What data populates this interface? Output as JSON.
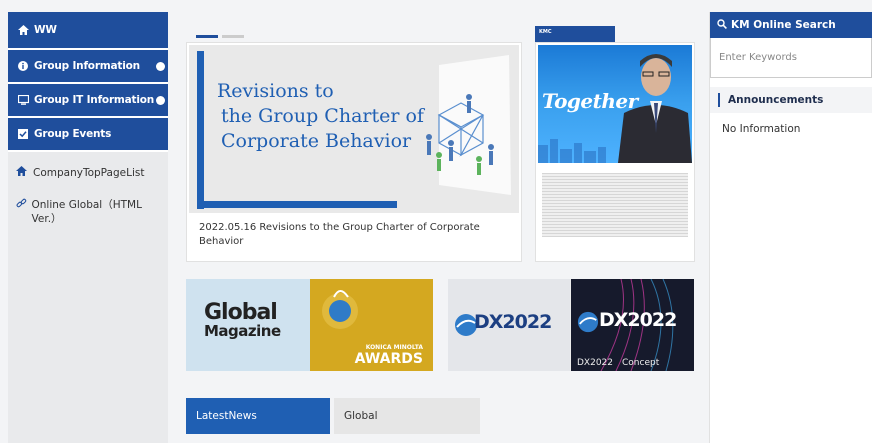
{
  "sidebar": {
    "primary": [
      {
        "label": "WW",
        "icon": "home-icon"
      },
      {
        "label": "Group Information",
        "icon": "info-icon"
      },
      {
        "label": "Group IT Information",
        "icon": "monitor-icon"
      },
      {
        "label": "Group Events",
        "icon": "checkbox-icon"
      }
    ],
    "secondary": [
      {
        "label": "CompanyTopPageList",
        "icon": "home-icon"
      },
      {
        "label": "Online Global（HTML Ver.）",
        "icon": "link-icon"
      }
    ]
  },
  "hero": {
    "title_line1": "Revisions to",
    "title_line2": "the Group Charter of",
    "title_line3": "Corporate Behavior",
    "caption": "2022.05.16 Revisions to the Group Charter of Corporate Behavior",
    "active_slide": 1,
    "slide_count": 2
  },
  "promo": {
    "header": "KMC",
    "word": "Together"
  },
  "banners": {
    "global_magazine_line1": "Global",
    "global_magazine_line2": "Magazine",
    "awards_brand": "KONICA MINOLTA",
    "awards_label": "AWARDS",
    "dx_label_left": "DX2022",
    "dx_label_right": "DX2022",
    "dx_caption": "DX2022　Concept"
  },
  "news_tabs": [
    {
      "label": "LatestNews",
      "active": true
    },
    {
      "label": "Global",
      "active": false
    }
  ],
  "right": {
    "search_title": "KM Online Search",
    "search_placeholder": "Enter Keywords",
    "announcements_title": "Announcements",
    "announcements_empty": "No Information"
  },
  "colors": {
    "brand_blue": "#1f4e9c",
    "accent_blue": "#1f5fb3",
    "awards_gold": "#d4a820"
  }
}
